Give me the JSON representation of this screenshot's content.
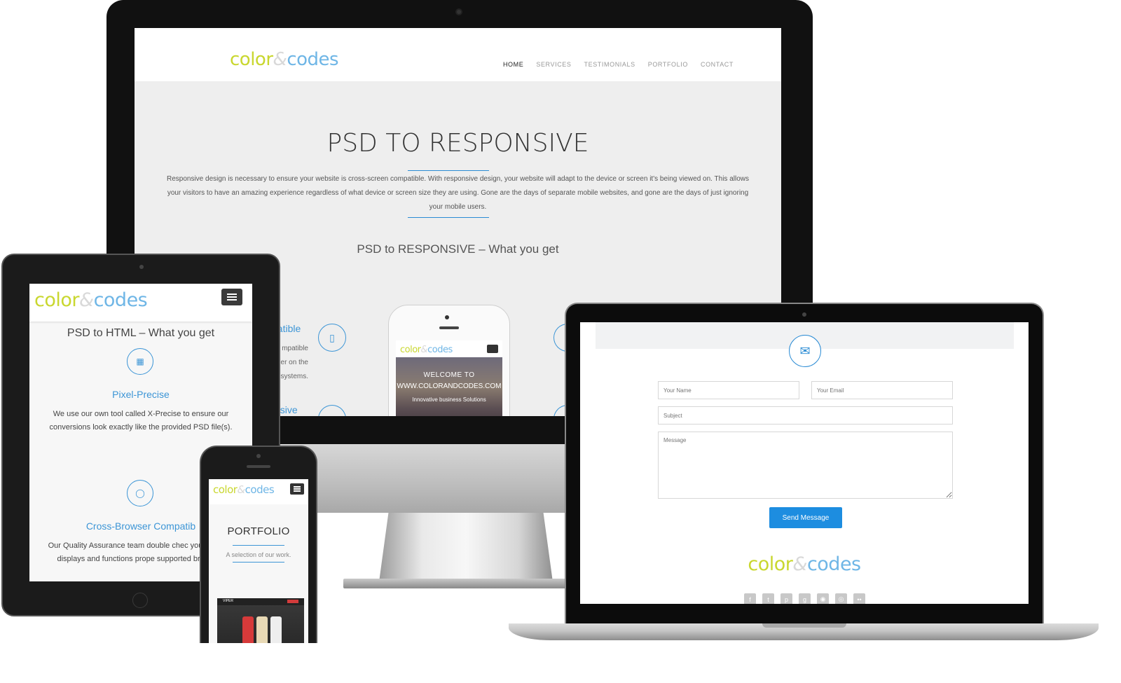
{
  "desktop": {
    "logo": {
      "part1": "color",
      "amp": "&",
      "part2": "codes"
    },
    "nav": [
      "HOME",
      "SERVICES",
      "TESTIMONIALS",
      "PORTFOLIO",
      "CONTACT"
    ],
    "active_nav": "HOME",
    "title": "PSD TO RESPONSIVE",
    "paragraph": "Responsive design is necessary to ensure your website is cross-screen compatible. With responsive design, your website will adapt to the device or screen it's being viewed on. This allows your visitors to have an amazing experience regardless of what device or screen size they are using. Gone are the days of separate mobile websites, and gone are the days of just ignoring your mobile users.",
    "subtitle": "PSD to RESPONSIVE – What you get",
    "side_heading_1": "patible",
    "side_lines": [
      "mpatible",
      "er on the",
      "systems."
    ],
    "side_heading_2": "nsive",
    "phone": {
      "logo": {
        "part1": "color",
        "amp": "&",
        "part2": "codes"
      },
      "welcome": "WELCOME TO",
      "site": "WWW.COLORANDCODES.COM",
      "tagline": "Innovative business Solutions"
    }
  },
  "tablet": {
    "logo": {
      "part1": "color",
      "amp": "&",
      "part2": "codes"
    },
    "title": "PSD to HTML – What you get",
    "features": [
      {
        "title": "Pixel-Precise",
        "text": "We use our own tool called X-Precise to ensure our conversions look exactly like the provided PSD file(s).",
        "icon": "grid-icon"
      },
      {
        "title": "Cross-Browser Compatib",
        "text": "Our Quality Assurance team double chec your website displays and functions prope supported browsers",
        "icon": "globe-icon"
      }
    ]
  },
  "phone": {
    "logo": {
      "part1": "color",
      "amp": "&",
      "part2": "codes"
    },
    "title": "PORTFOLIO",
    "subtitle": "A selection of our work.",
    "thumb_brand": "VIPER"
  },
  "laptop": {
    "placeholders": {
      "name": "Your Name",
      "email": "Your Email",
      "subject": "Subject",
      "message": "Message"
    },
    "send_label": "Send Message",
    "logo": {
      "part1": "color",
      "amp": "&",
      "part2": "codes"
    },
    "social": [
      "facebook-icon",
      "twitter-icon",
      "pinterest-icon",
      "google-plus-icon",
      "instagram-icon",
      "dribbble-icon",
      "flickr-icon"
    ]
  },
  "colors": {
    "brand_green": "#c9d72f",
    "brand_blue": "#6fb6e6",
    "accent": "#2a8bd4",
    "button": "#1d8de0"
  }
}
